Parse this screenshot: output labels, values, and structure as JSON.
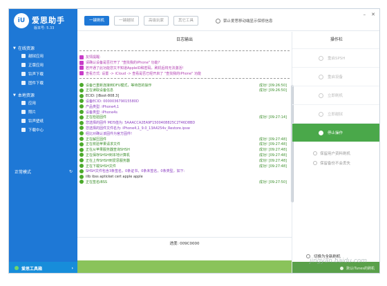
{
  "app": {
    "logo_text": "iU",
    "name": "爱思助手",
    "version": "版本号: 5.33"
  },
  "sidebar": {
    "online_section": "在线资源",
    "online_items": [
      "越狱应用",
      "正版应用",
      "铃声下载",
      "固件下载"
    ],
    "local_section": "本地资源",
    "local_items": [
      "应用",
      "照片",
      "铃声壁纸",
      "下载中心"
    ],
    "mode_label": "正常模式",
    "toolbox_label": "爱思工具箱"
  },
  "toolbar": {
    "buttons": [
      "一键刷机",
      "一键越狱",
      "高级玩家",
      "其它工具"
    ],
    "radio_label": "禁止爱思移动端显示保修信息"
  },
  "log": {
    "title": "日志输出",
    "notice_lines": [
      "友情提醒:",
      "请确认设备是否打开了 \"查找我的iPhone\" 功能?",
      "若开通了此功能您又不知道AppleID和密码，刷机后将无法激活!",
      "查看方式: 设置 -> iCloud -> 查看是否已经开启了 \"查找我的iPhone\" 功能"
    ],
    "entries": [
      {
        "text": "设备已重新连接到DFU模式，等待您的操作",
        "res": "成功! [09:26:50]",
        "cls": "t-info"
      },
      {
        "text": "正在读取设备信息",
        "res": "成功! [09:26:50]",
        "cls": "t-info"
      },
      {
        "text": "ECID: [iBoot-808.3]",
        "res": "",
        "cls": "t-dark"
      },
      {
        "text": "设备ECID: 000003679015580D",
        "res": "",
        "cls": "t-purple"
      },
      {
        "text": "产品类型: iPhone4,1",
        "res": "",
        "cls": "t-purple"
      },
      {
        "text": "设备类型: iPhone4s",
        "res": "",
        "cls": "t-purple"
      },
      {
        "text": "正在检验固件",
        "res": "成功! [09:27:14]",
        "cls": "t-info"
      },
      {
        "text": "您选择的固件 MD5值为: 5AAACCA2EA9F1500408825C2T46D8BD",
        "res": "",
        "cls": "t-purple"
      },
      {
        "text": "您选择的固件文件名为: iPhone4,1_9.0_13A4254v_Restore.ipsw",
        "res": "",
        "cls": "t-purple"
      },
      {
        "text": "经比对确认该固件为官方固件!",
        "res": "",
        "cls": "t-purple"
      },
      {
        "text": "正在解压固件",
        "res": "成功! [09:27:48]",
        "cls": "t-info"
      },
      {
        "text": "正在校验苹果请求文件",
        "res": "成功! [09:27:48]",
        "cls": "t-info"
      },
      {
        "text": "正在从苹果服务器查询SHSH",
        "res": "成功! [09:27:48]",
        "cls": "t-info"
      },
      {
        "text": "正在保存SHSH到本地计算机",
        "res": "成功! [09:27:48]",
        "cls": "t-info"
      },
      {
        "text": "正在上传SHSH到爱思服务器",
        "res": "成功! [09:27:48]",
        "cls": "t-info"
      },
      {
        "text": "正在下载SHSH文件",
        "res": "成功! [09:27:48]",
        "cls": "t-info"
      },
      {
        "text": "SHSH文件包含3条签名，0条证书，0条未签名，0条类型，如下:",
        "res": "",
        "cls": "t-purple"
      },
      {
        "text": "illb ibss apticket cert apple apple",
        "res": "",
        "cls": "t-dark"
      },
      {
        "text": "正在签名iBSS",
        "res": "成功! [09:27:50]",
        "cls": "t-info"
      }
    ]
  },
  "status": {
    "progress_text": "进度: 009C0000"
  },
  "panel": {
    "title": "操作栏",
    "ops": [
      {
        "label": "重启SPSH",
        "active": false
      },
      {
        "label": "重启设备",
        "active": false
      },
      {
        "label": "立即刷机",
        "active": false
      },
      {
        "label": "立即越狱",
        "active": false
      },
      {
        "label": "停止操作",
        "active": true
      }
    ],
    "options": [
      "保留用户资料刷机",
      "保留备份不会丢失"
    ],
    "mode_switch": "切换为全新刷机",
    "footer": "默认iTunes的刷机",
    "watermark": "jingyan.baidu.com"
  }
}
